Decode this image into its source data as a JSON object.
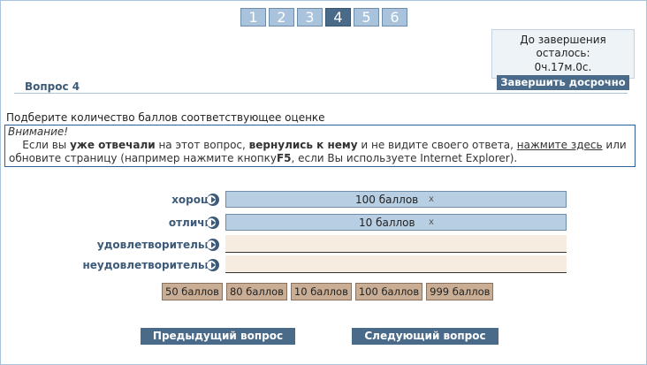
{
  "tabs": [
    "1",
    "2",
    "3",
    "4",
    "5",
    "6"
  ],
  "active_tab": "4",
  "timer": {
    "label": "До завершения осталось:",
    "value": "0ч.17м.0с.",
    "finish_button": "Завершить досрочно"
  },
  "question": {
    "title": "Вопрос 4",
    "instruction": "Подберите количество баллов соответствующее оценке"
  },
  "notice": {
    "title": "Внимание!",
    "part1": "Если вы ",
    "bold1": "уже отвечали",
    "part2": " на этот вопрос, ",
    "bold2": "вернулись к нему",
    "part3": " и не видите своего ответа, ",
    "link": "нажмите здесь",
    "part4": " или обновите страницу (например нажмите кнопку",
    "bold3": "F5",
    "part5": ", если Вы используете Internet Explorer)."
  },
  "rows": [
    {
      "label": "хорошо",
      "value": "100 баллов",
      "remove": "x"
    },
    {
      "label": "отлично",
      "value": "10 баллов",
      "remove": "x"
    },
    {
      "label": "удовлетворительно",
      "value": "",
      "remove": ""
    },
    {
      "label": "неудовлетворительно",
      "value": "",
      "remove": ""
    }
  ],
  "options": [
    "50 баллов",
    "80 баллов",
    "10 баллов",
    "100 баллов",
    "999 баллов"
  ],
  "nav": {
    "prev": "Предыдущий вопрос",
    "next": "Следующий вопрос"
  },
  "colors": {
    "tab": "#a9c3dc",
    "tab_active": "#4a6a8a",
    "slot_filled": "#b8cee2",
    "slot_empty": "#f6ece0",
    "option": "#c9ad94",
    "button": "#4a6a8a"
  }
}
